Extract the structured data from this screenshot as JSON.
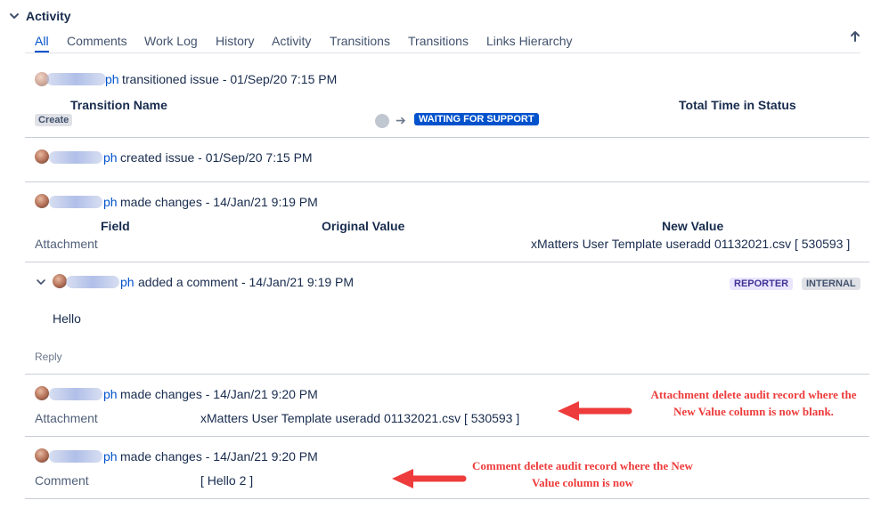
{
  "activity": {
    "title": "Activity",
    "tabs": [
      {
        "label": "All",
        "active": true
      },
      {
        "label": "Comments"
      },
      {
        "label": "Work Log"
      },
      {
        "label": "History"
      },
      {
        "label": "Activity"
      },
      {
        "label": "Transitions"
      },
      {
        "label": "Transitions"
      },
      {
        "label": "Links Hierarchy"
      }
    ]
  },
  "entries": [
    {
      "name_suffix": "ph",
      "action": "transitioned issue - 01/Sep/20 7:15 PM",
      "headers": {
        "transition_name": "Transition Name",
        "total_time": "Total Time in Status"
      },
      "from_status": "Create",
      "to_status": "WAITING FOR SUPPORT"
    },
    {
      "name_suffix": "ph",
      "action": "created issue - 01/Sep/20 7:15 PM"
    },
    {
      "name_suffix": "ph",
      "action": "made changes - 14/Jan/21 9:19 PM",
      "headers": {
        "field": "Field",
        "original": "Original Value",
        "new": "New Value"
      },
      "row": {
        "field": "Attachment",
        "original": "",
        "new": "xMatters User Template useradd 01132021.csv [ 530593 ]"
      }
    },
    {
      "name_suffix": "ph",
      "action": "added a comment - 14/Jan/21 9:19 PM",
      "tags": [
        "REPORTER",
        "INTERNAL"
      ],
      "body": "Hello",
      "reply_label": "Reply"
    },
    {
      "name_suffix": "ph",
      "action": "made changes - 14/Jan/21 9:20 PM",
      "row": {
        "field": "Attachment",
        "original": "xMatters User Template useradd 01132021.csv [ 530593 ]",
        "new": ""
      }
    },
    {
      "name_suffix": "ph",
      "action": "made changes - 14/Jan/21 9:20 PM",
      "row": {
        "field": "Comment",
        "original": "[ Hello 2 ]",
        "new": ""
      }
    }
  ],
  "annotations": [
    {
      "text": "Attachment delete audit record where the New Value column is now blank.",
      "color": "#ee3b3b"
    },
    {
      "text": "Comment delete audit record where the New Value column is now",
      "color": "#ee3b3b"
    }
  ],
  "icons": {
    "collapse": "chevron-down-icon",
    "scroll_top": "arrow-up-icon",
    "status_arrow": "arrow-right-icon"
  },
  "colors": {
    "link": "#0052cc",
    "status_blue": "#0052cc",
    "annotation_red": "#ee3b3b"
  }
}
